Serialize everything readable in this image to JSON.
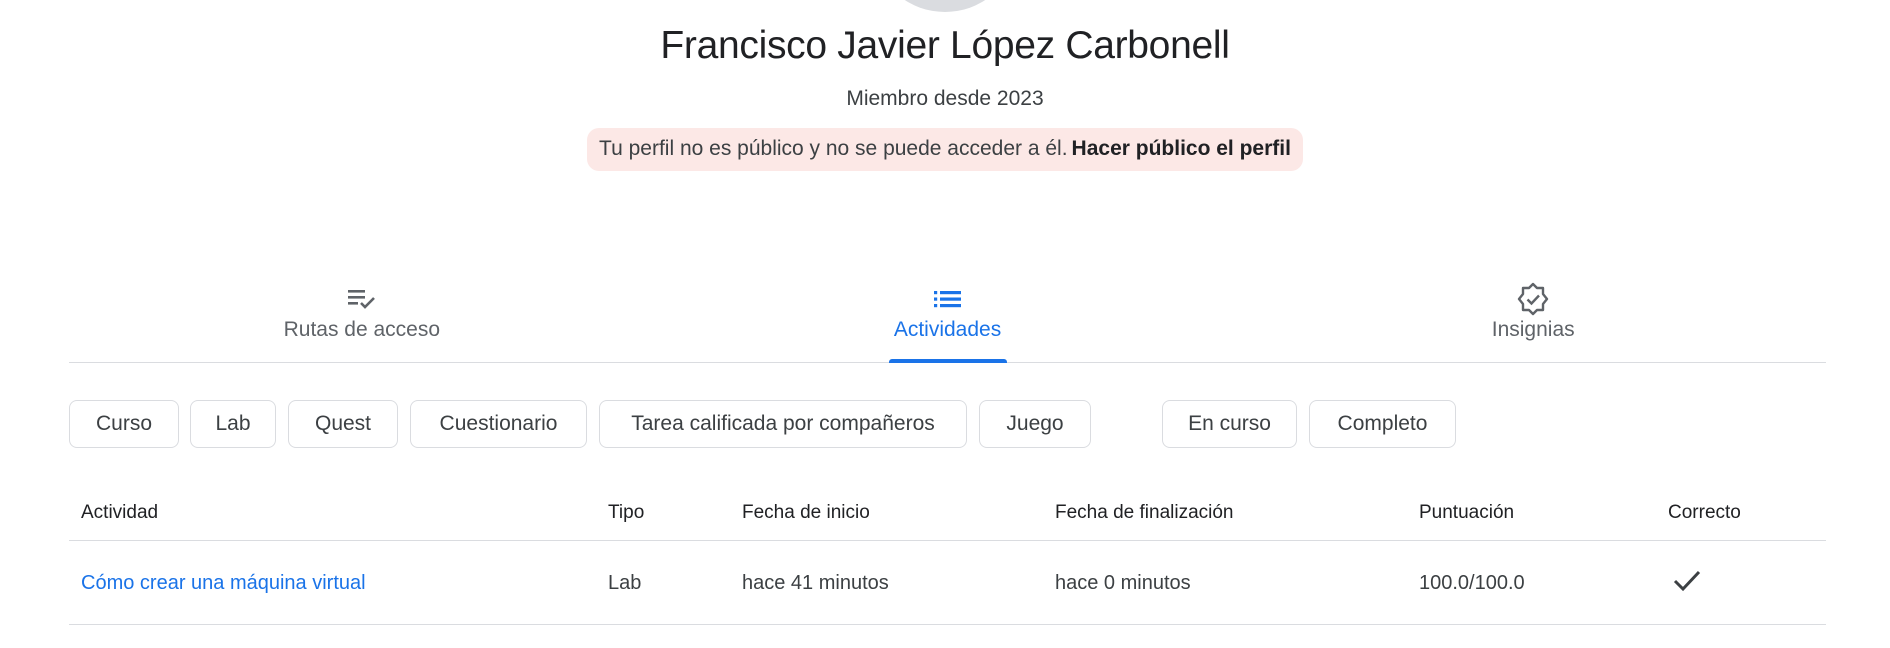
{
  "profile": {
    "name": "Francisco Javier López Carbonell",
    "member_since": "Miembro desde 2023",
    "privacy_notice": "Tu perfil no es público y no se puede acceder a él.",
    "privacy_action": "Hacer público el perfil"
  },
  "tabs": [
    {
      "label": "Rutas de acceso",
      "icon": "playlist-check-icon",
      "active": false
    },
    {
      "label": "Actividades",
      "icon": "list-icon",
      "active": true
    },
    {
      "label": "Insignias",
      "icon": "verified-badge-icon",
      "active": false
    }
  ],
  "filters": {
    "type_chips": [
      "Curso",
      "Lab",
      "Quest",
      "Cuestionario",
      "Tarea calificada por compañeros",
      "Juego"
    ],
    "status_chips": [
      "En curso",
      "Completo"
    ]
  },
  "table": {
    "headers": [
      "Actividad",
      "Tipo",
      "Fecha de inicio",
      "Fecha de finalización",
      "Puntuación",
      "Correcto"
    ],
    "rows": [
      {
        "activity": "Cómo crear una máquina virtual",
        "type": "Lab",
        "start": "hace 41 minutos",
        "end": "hace 0 minutos",
        "score": "100.0/100.0",
        "correct_icon": "check-icon"
      }
    ]
  },
  "colors": {
    "accent": "#1a73e8",
    "notice_bg": "#fce8e6",
    "border": "#dadce0"
  }
}
